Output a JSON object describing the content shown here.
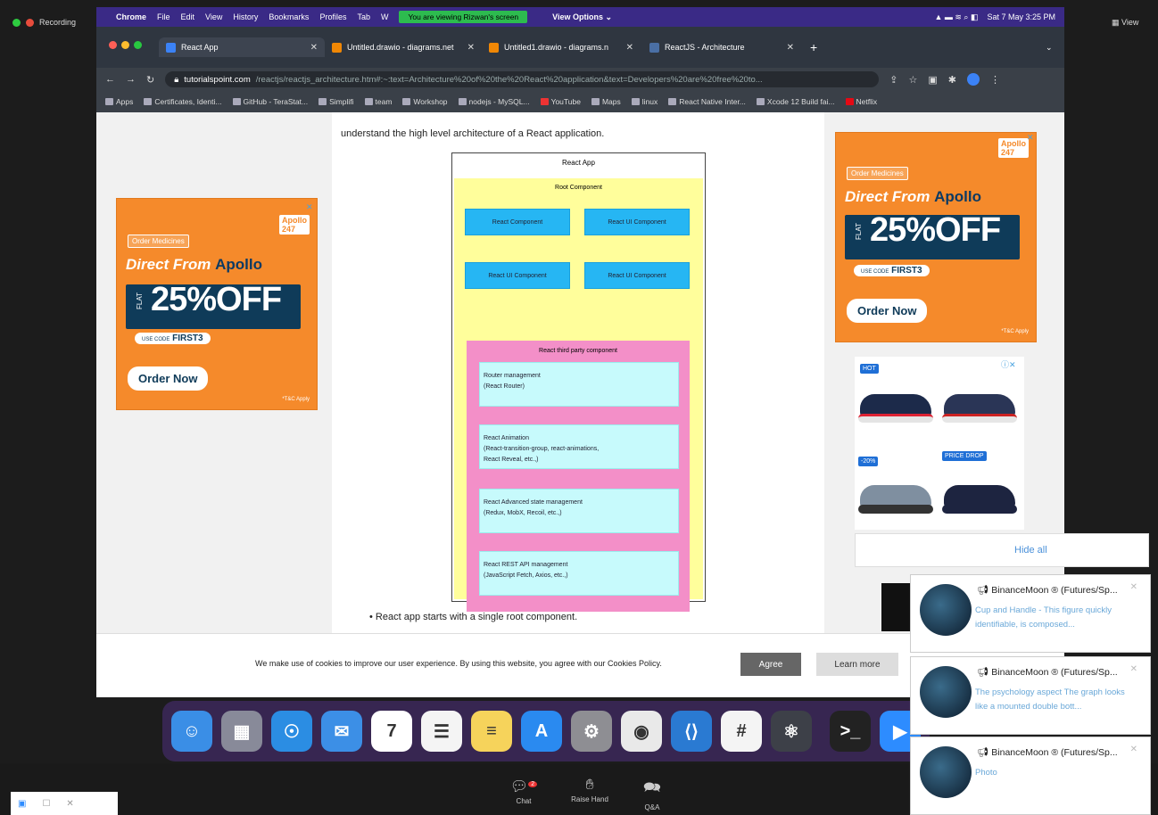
{
  "zoom": {
    "recording_label": "Recording",
    "view_label": "View",
    "bottom_buttons": [
      {
        "label": "Chat",
        "icon": "chat-icon"
      },
      {
        "label": "Raise Hand",
        "icon": "hand-icon"
      },
      {
        "label": "Q&A",
        "icon": "qa-icon"
      }
    ],
    "chat_badge": "2"
  },
  "menubar": {
    "app": "Chrome",
    "items": [
      "File",
      "Edit",
      "View",
      "History",
      "Bookmarks",
      "Profiles",
      "Tab",
      "W"
    ],
    "share_notice": "You are viewing Rizwan's screen",
    "view_options": "View Options",
    "clock": "Sat 7 May 3:25 PM"
  },
  "tabs": [
    {
      "title": "React App",
      "active": true,
      "color": "#3b82f6"
    },
    {
      "title": "Untitled.drawio - diagrams.net",
      "active": false,
      "color": "#f08705"
    },
    {
      "title": "Untitled1.drawio - diagrams.n",
      "active": false,
      "color": "#f08705"
    },
    {
      "title": "ReactJS - Architecture",
      "active": false,
      "color": "#4a6fa5"
    }
  ],
  "address": {
    "domain": "tutorialspoint.com",
    "path": "/reactjs/reactjs_architecture.htm#:~:text=Architecture%20of%20the%20React%20application&text=Developers%20are%20free%20to..."
  },
  "bookmarks": [
    "Apps",
    "Certificates, Identi...",
    "GitHub - TeraStat...",
    "Simplifi",
    "team",
    "Workshop",
    "nodejs - MySQL...",
    "YouTube",
    "Maps",
    "linux",
    "React Native Inter...",
    "Xcode 12 Build fai...",
    "Netflix"
  ],
  "page": {
    "intro": "understand the high level architecture of a React application.",
    "bullet": "React app starts with a single root component.",
    "cookie_text": "We make use of cookies to improve our user experience. By using this website, you agree with our Cookies Policy.",
    "agree": "Agree",
    "learn_more": "Learn more"
  },
  "diagram": {
    "title": "React App",
    "root_title": "Root Component",
    "components": [
      "React Component",
      "React UI Component",
      "React UI Component",
      "React UI Component"
    ],
    "third_party_title": "React third party component",
    "third_party": [
      [
        "Router management",
        "(React Router)"
      ],
      [
        "React Animation",
        "(React-transition-group, react-animations,",
        "React Reveal, etc.,)"
      ],
      [
        "React Advanced state management",
        "(Redux, MobX, Recoil, etc.,)"
      ],
      [
        "React REST API management",
        "(JavaScript Fetch, Axios, etc.,)"
      ]
    ]
  },
  "ads": {
    "apollo": {
      "tag": "Order Medicines",
      "headline_a": "Direct From ",
      "headline_b": "Apollo",
      "flat": "FLAT",
      "off": "25%OFF",
      "code_prefix": "USE CODE",
      "code": "FIRST3",
      "cta": "Order Now",
      "logo": "247",
      "logo_top": "Apollo",
      "tc": "*T&C Apply"
    },
    "shoe_badges": [
      "HOT",
      "-20%",
      "PRICE DROP"
    ],
    "hide_all": "Hide all"
  },
  "notifications": [
    {
      "name": "BinanceMoon ® (Futures/Sp...",
      "message": "Cup and Handle - This figure quickly identifiable, is composed..."
    },
    {
      "name": "BinanceMoon ® (Futures/Sp...",
      "message": "The psychology aspect The graph looks like a mounted double bott..."
    },
    {
      "name": "BinanceMoon ® (Futures/Sp...",
      "message": "Photo"
    }
  ],
  "dock": [
    {
      "name": "finder-icon",
      "color": "#3a8ee6",
      "glyph": "☺"
    },
    {
      "name": "launchpad-icon",
      "color": "#888a99",
      "glyph": "▦"
    },
    {
      "name": "safari-icon",
      "color": "#2b8de3",
      "glyph": "☉"
    },
    {
      "name": "mail-icon",
      "color": "#3c8fe6",
      "glyph": "✉"
    },
    {
      "name": "calendar-icon",
      "color": "#ffffff",
      "glyph": "7"
    },
    {
      "name": "reminders-icon",
      "color": "#f4f4f4",
      "glyph": "☰"
    },
    {
      "name": "notes-icon",
      "color": "#f6d35b",
      "glyph": "≡"
    },
    {
      "name": "app-store-icon",
      "color": "#2a8af0",
      "glyph": "A"
    },
    {
      "name": "system-preferences-icon",
      "color": "#8e8e93",
      "glyph": "⚙"
    },
    {
      "name": "chrome-icon",
      "color": "#e9e9e9",
      "glyph": "◉"
    },
    {
      "name": "vscode-icon",
      "color": "#2a7ad2",
      "glyph": "⟨⟩"
    },
    {
      "name": "slack-icon",
      "color": "#f4f4f4",
      "glyph": "#"
    },
    {
      "name": "atom-icon",
      "color": "#3d4048",
      "glyph": "⚛"
    },
    {
      "name": "terminal-icon",
      "color": "#222",
      "glyph": ">_"
    },
    {
      "name": "zoom-icon",
      "color": "#2d8cff",
      "glyph": "▶"
    }
  ]
}
